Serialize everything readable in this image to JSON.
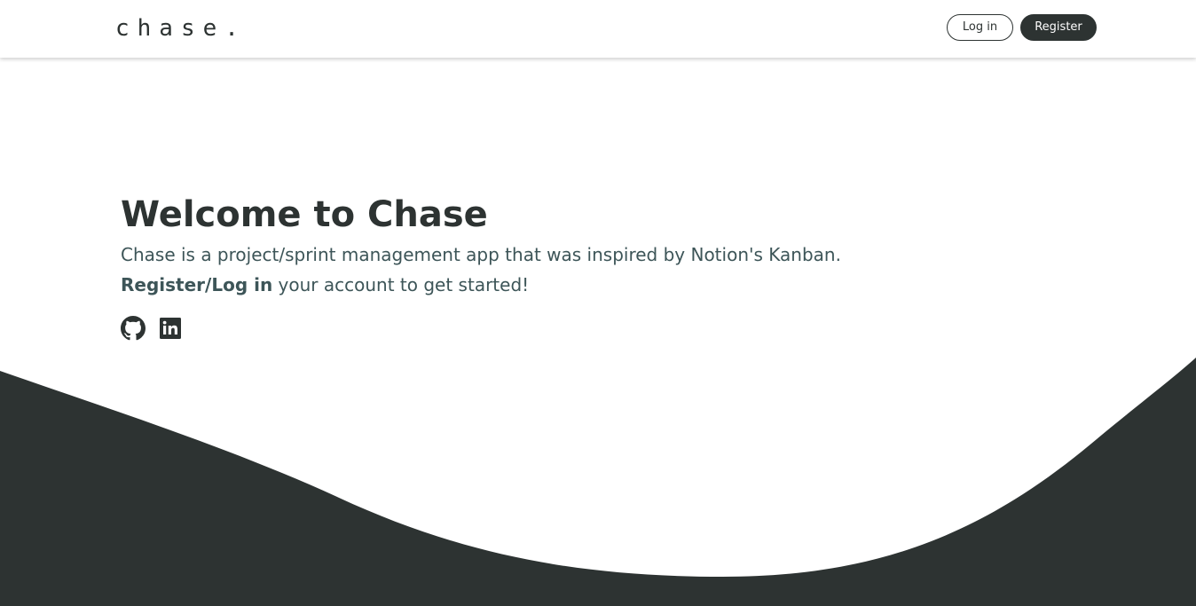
{
  "header": {
    "brand": "chase.",
    "login_label": "Log in",
    "register_label": "Register"
  },
  "hero": {
    "title": "Welcome to Chase",
    "description": "Chase is a project/sprint management app that was inspired by Notion's Kanban.",
    "cta_link": "Register/Log in",
    "cta_rest": " your account to get started!"
  },
  "socials": [
    {
      "icon": "github-icon"
    },
    {
      "icon": "linkedin-icon"
    }
  ],
  "colors": {
    "dark": "#2d3332",
    "text_muted": "#3d5558",
    "background": "#ffffff"
  }
}
